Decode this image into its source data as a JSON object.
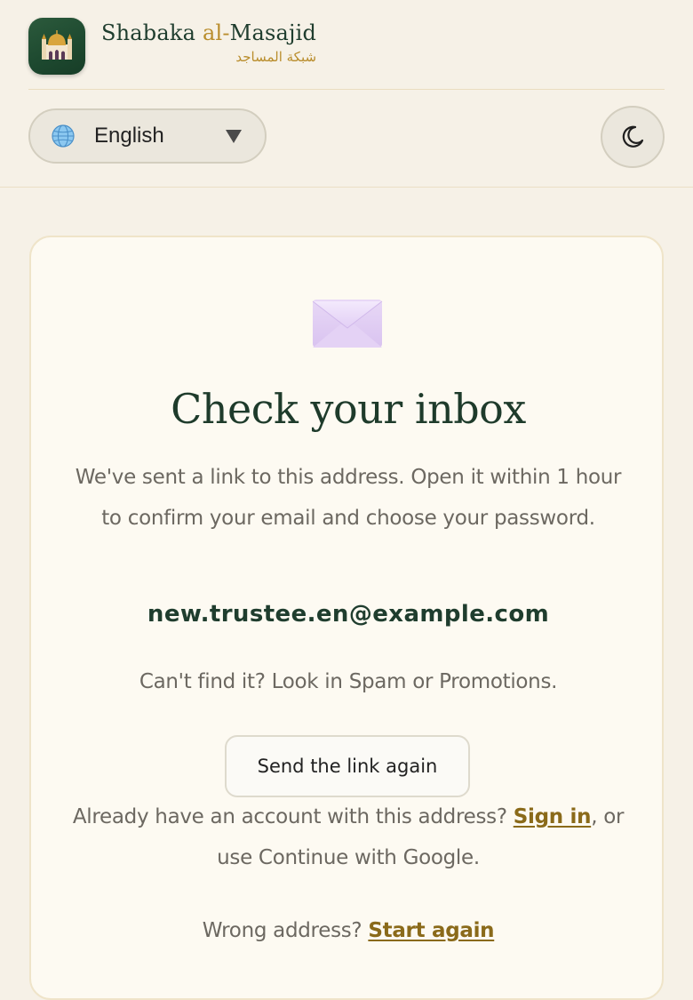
{
  "header": {
    "brand_name_part1": "Shabaka ",
    "brand_name_accent": "al-",
    "brand_name_part2": "Masajid",
    "brand_arabic": "شبكة المساجد",
    "app_icon": "mosque-icon",
    "language": {
      "icon": "globe-icon",
      "selected": "English",
      "dropdown_icon": "caret-down-icon"
    },
    "theme_toggle_icon": "moon-icon"
  },
  "card": {
    "icon": "envelope-icon",
    "title": "Check your inbox",
    "description": "We've sent a link to this address. Open it within 1 hour to confirm your email and choose your password.",
    "email": "new.trustee.en@example.com",
    "hint": "Can't find it? Look in Spam or Promotions.",
    "resend_button": "Send the link again",
    "signin_prefix": "Already have an account with this address? ",
    "signin_link": "Sign in",
    "signin_suffix": ", or use Continue with Google.",
    "wrong_prefix": "Wrong address? ",
    "wrong_link": "Start again"
  },
  "colors": {
    "background": "#f6f1e7",
    "brand_green": "#1f3d2e",
    "brand_gold": "#b98d2c",
    "link": "#8a6a1a",
    "card": "#fdfaf2"
  }
}
